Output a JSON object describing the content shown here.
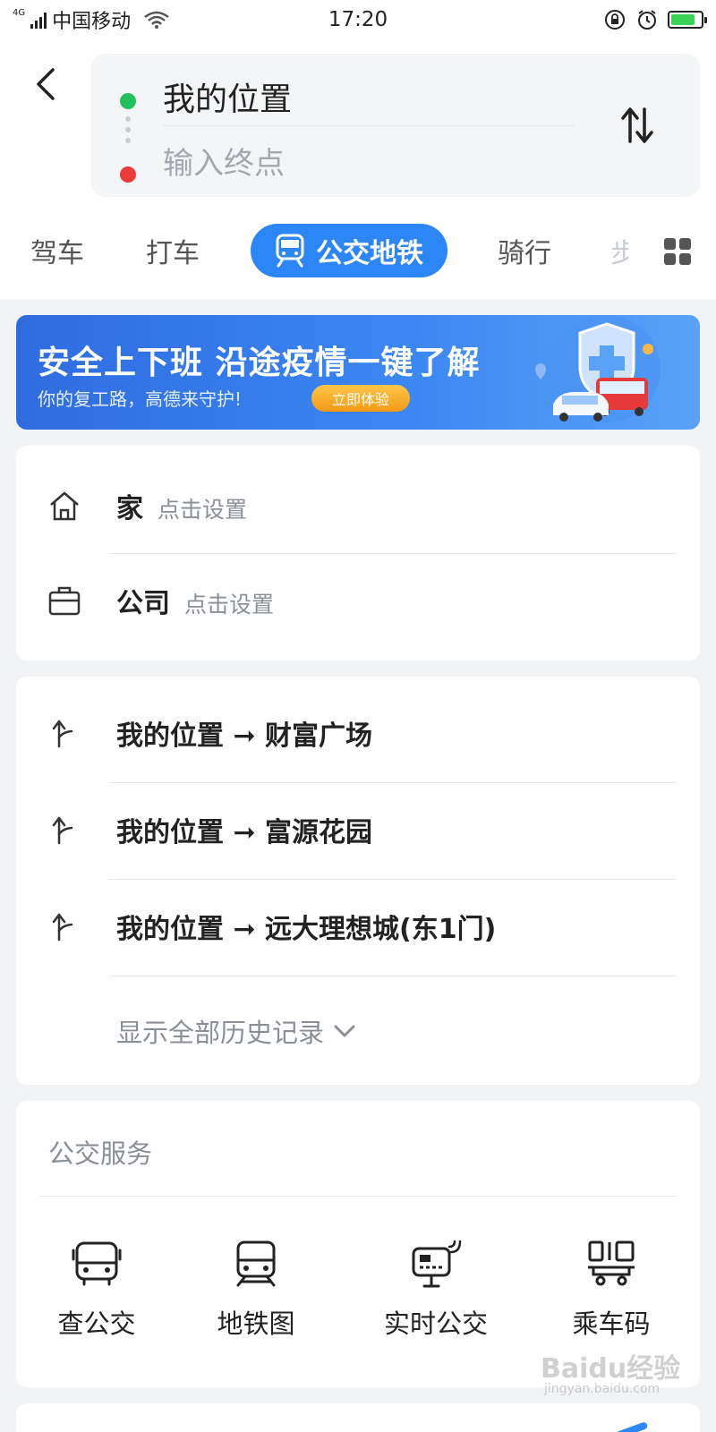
{
  "status_bar": {
    "network_type": "4G",
    "carrier": "中国移动",
    "time": "17:20",
    "battery_level": 0.8
  },
  "route": {
    "start_label": "我的位置",
    "end_placeholder": "输入终点",
    "end_value": ""
  },
  "transport_modes": [
    {
      "label": "驾车",
      "active": false
    },
    {
      "label": "打车",
      "active": false
    },
    {
      "label": "公交地铁",
      "active": true
    },
    {
      "label": "骑行",
      "active": false
    },
    {
      "label": "步",
      "active": false
    }
  ],
  "banner": {
    "title": "安全上下班 沿途疫情一键了解",
    "subtitle": "你的复工路，高德来守护!",
    "cta": "立即体验"
  },
  "saved_places": [
    {
      "name": "家",
      "hint": "点击设置",
      "icon": "home-icon"
    },
    {
      "name": "公司",
      "hint": "点击设置",
      "icon": "briefcase-icon"
    }
  ],
  "history": {
    "items": [
      "我的位置 ➞ 财富广场",
      "我的位置 ➞ 富源花园",
      "我的位置 ➞ 远大理想城(东1门)"
    ],
    "show_all": "显示全部历史记录"
  },
  "bus_services": {
    "title": "公交服务",
    "items": [
      {
        "label": "查公交",
        "icon": "bus-icon"
      },
      {
        "label": "地铁图",
        "icon": "subway-icon"
      },
      {
        "label": "实时公交",
        "icon": "realtime-bus-icon"
      },
      {
        "label": "乘车码",
        "icon": "ride-code-icon"
      }
    ]
  },
  "watermark": {
    "text": "Baidu经验",
    "sub": "jingyan.baidu.com"
  },
  "colors": {
    "accent": "#2d86f6",
    "start_dot": "#22c05d",
    "end_dot": "#ec3b3b"
  }
}
